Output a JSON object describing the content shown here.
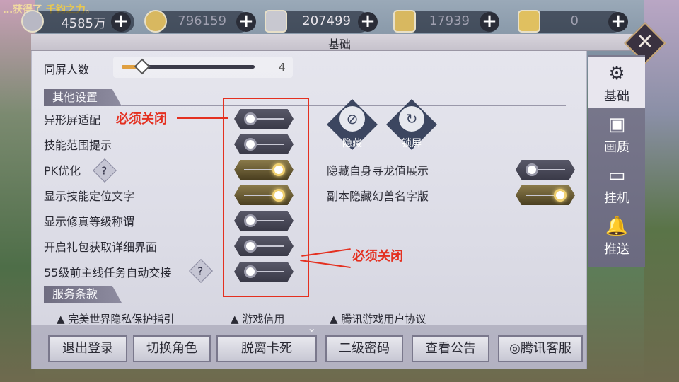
{
  "announcement": {
    "prefix": "…获得了",
    "highlight": "千钧之力",
    "suffix": "。"
  },
  "currency": [
    {
      "icon": "silver-coin-icon",
      "value": "4585万"
    },
    {
      "icon": "gold-coin-icon",
      "value": "796159"
    },
    {
      "icon": "silver-ingot-icon",
      "value": "207499"
    },
    {
      "icon": "locked-gold-ingot-icon",
      "value": "17939"
    },
    {
      "icon": "gold-ingot-icon",
      "value": "0"
    }
  ],
  "plus_label": "+",
  "window": {
    "title": "基础",
    "close_label": "✕"
  },
  "tabs": [
    {
      "icon": "gear-icon",
      "glyph": "⚙",
      "label": "基础",
      "active": true
    },
    {
      "icon": "image-icon",
      "glyph": "▣",
      "label": "画质"
    },
    {
      "icon": "monitor-icon",
      "glyph": "▭",
      "label": "挂机"
    },
    {
      "icon": "bell-icon",
      "glyph": "🔔",
      "label": "推送"
    }
  ],
  "slider": {
    "label": "同屏人数",
    "value": "4",
    "fraction": 0.12
  },
  "sections": {
    "other": "其他设置",
    "service": "服务条款"
  },
  "settings_left": [
    {
      "label": "异形屏适配",
      "on": false
    },
    {
      "label": "技能范围提示",
      "on": false
    },
    {
      "label": "PK优化",
      "on": true,
      "help": true
    },
    {
      "label": "显示技能定位文字",
      "on": true
    },
    {
      "label": "显示修真等级称谓",
      "on": false
    },
    {
      "label": "开启礼包获取详细界面",
      "on": false
    },
    {
      "label": "55级前主线任务自动交接",
      "on": false,
      "help": true
    }
  ],
  "help_label": "?",
  "settings_right": [
    {
      "label": "隐藏自身寻龙值展示",
      "on": false
    },
    {
      "label": "副本隐藏幻兽名字版",
      "on": true
    }
  ],
  "action_buttons": [
    {
      "icon": "eye-slash-icon",
      "glyph": "⊘",
      "label": "隐藏"
    },
    {
      "icon": "lock-screen-icon",
      "glyph": "↻",
      "label": "锁屏"
    }
  ],
  "annotations": {
    "top": "必须关闭",
    "bottom": "必须关闭"
  },
  "terms": [
    "完美世界隐私保护指引",
    "游戏信用",
    "腾讯游戏用户协议"
  ],
  "footer_buttons": [
    "退出登录",
    "切换角色",
    "脱离卡死",
    "二级密码",
    "查看公告",
    "腾讯客服"
  ],
  "colors": {
    "annotation_red": "#e43020",
    "toggle_on": "#e0c060",
    "accent_gold": "#c8a878"
  }
}
